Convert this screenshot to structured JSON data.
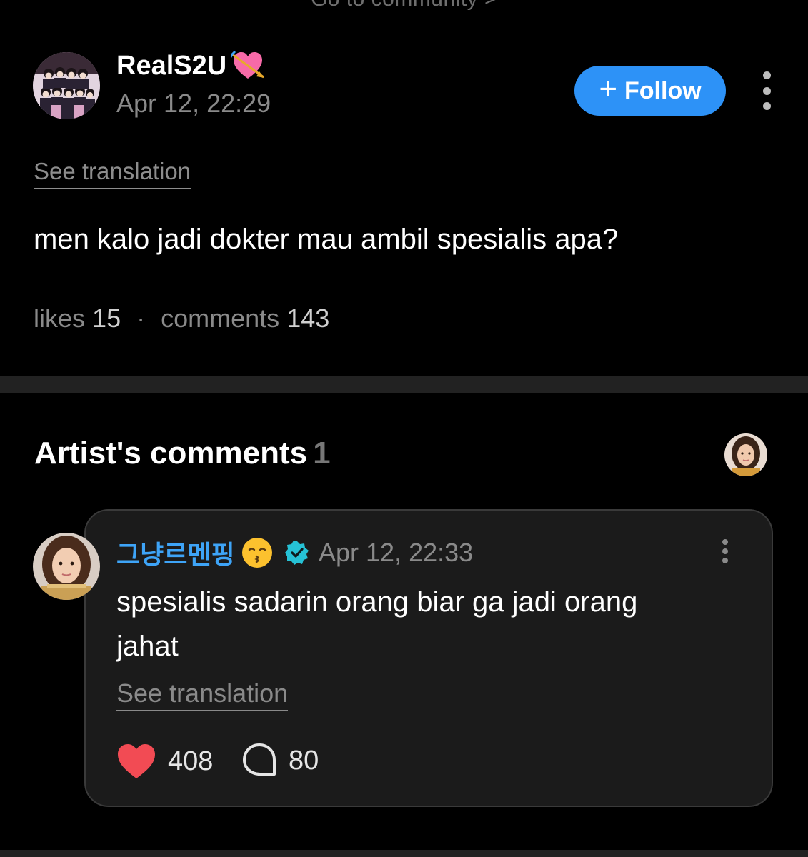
{
  "top_link": {
    "label": "Go to community >"
  },
  "post": {
    "username": "RealS2U",
    "date": "Apr 12, 22:29",
    "follow_label": "Follow",
    "see_translation": "See translation",
    "body": "men kalo jadi dokter mau ambil spesialis apa?",
    "likes_label": "likes",
    "likes_count": "15",
    "comments_label": "comments",
    "comments_count": "143"
  },
  "artist_comments": {
    "heading": "Artist's comments",
    "count": "1"
  },
  "comment": {
    "author": "그냥르멘핑",
    "date": "Apr 12, 22:33",
    "body": "spesialis sadarin orang biar ga jadi orang jahat",
    "see_translation": "See translation",
    "likes": "408",
    "replies": "80"
  },
  "colors": {
    "background": "#000000",
    "accent": "#2d92f7",
    "author_name": "#3ea4f7",
    "heart": "#f24b54",
    "card": "#1b1b1b"
  },
  "icons": {
    "username_badge": "heart-with-arrow-icon",
    "follow": "plus-icon",
    "menu": "more-vertical-icon",
    "author_emoji": "kissing-face-icon",
    "verified": "verified-badge-icon",
    "like": "heart-icon",
    "reply": "speech-bubble-icon"
  }
}
